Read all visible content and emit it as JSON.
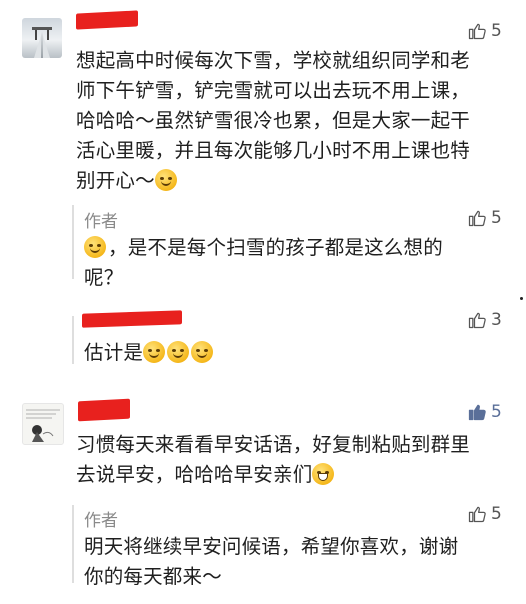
{
  "comments": [
    {
      "text": "想起高中时候每次下雪，学校就组织同学和老师下午铲雪，铲完雪就可以出去玩不用上课，哈哈哈～虽然铲雪很冷也累，但是大家一起干活心里暖，并且每次能够几小时不用上课也特别开心～",
      "lines": [
        "想起高中时候每次下雪，学校就组织同学和老",
        "师下午铲雪，铲完雪就可以出去玩不用上课，",
        "哈哈哈～虽然铲雪很冷也累，但是大家一起干",
        "活心里暖，并且每次能够几小时不用上课也特",
        "别开心～"
      ],
      "likes": "5",
      "liked": false,
      "emoji": "laughing-emoji",
      "reply": {
        "author": "作者",
        "lines": [
          "，是不是每个扫雪的孩子都是这么想的",
          "呢？"
        ],
        "likes": "5",
        "emoji": "smirk-emoji"
      },
      "sub_reply": {
        "likes": "3",
        "text": "估计是",
        "emoji": "thinking-emoji"
      }
    },
    {
      "lines": [
        "习惯每天来看看早安话语，好复制粘贴到群里",
        "去说早安，哈哈哈早安亲们"
      ],
      "likes": "5",
      "liked": true,
      "emoji": "grin-emoji",
      "reply": {
        "author": "作者",
        "lines": [
          "明天将继续早安问候语，希望你喜欢，谢谢",
          "你的每天都来～"
        ],
        "likes": "5"
      }
    }
  ],
  "colors": {
    "redaction": "#e8211e",
    "liked": "#5a6f99",
    "muted": "#8a8a8a"
  }
}
